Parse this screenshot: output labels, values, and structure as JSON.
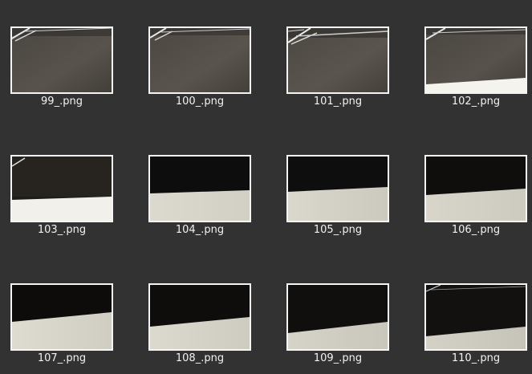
{
  "files": [
    {
      "name": "99_.png",
      "thumb": "gray-surface-with-cables"
    },
    {
      "name": "100_.png",
      "thumb": "gray-surface-with-cables"
    },
    {
      "name": "101_.png",
      "thumb": "gray-surface-with-cables"
    },
    {
      "name": "102_.png",
      "thumb": "gray-surface-with-white-edge"
    },
    {
      "name": "103_.png",
      "thumb": "dark-over-white"
    },
    {
      "name": "104_.png",
      "thumb": "dark-over-white"
    },
    {
      "name": "105_.png",
      "thumb": "dark-over-white"
    },
    {
      "name": "106_.png",
      "thumb": "dark-over-white"
    },
    {
      "name": "107_.png",
      "thumb": "dark-over-white-diagonal"
    },
    {
      "name": "108_.png",
      "thumb": "dark-over-white-diagonal"
    },
    {
      "name": "109_.png",
      "thumb": "dark-over-white-diagonal"
    },
    {
      "name": "110_.png",
      "thumb": "dark-over-white-diagonal"
    }
  ],
  "colors": {
    "background": "#323232",
    "thumbnail_border": "#f4f4f4",
    "label_text": "#f2f2f2"
  }
}
